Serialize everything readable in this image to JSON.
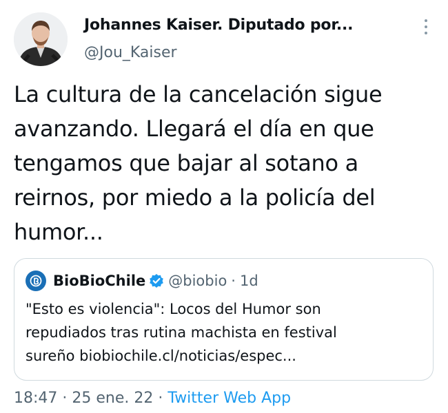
{
  "author": {
    "name": "Johannes Kaiser. Diputado por...",
    "handle": "@Jou_Kaiser"
  },
  "more_icon": "more-vertical-icon",
  "tweet": {
    "lines": [
      "La cultura de la cancelación sigue",
      "avanzando. Llegará el día en que",
      "tengamos que bajar al sotano a",
      "reirnos, por miedo a la policía del",
      "humor..."
    ]
  },
  "quoted": {
    "name": "BioBioChile",
    "handle": "@biobio",
    "separator": "·",
    "time": "1d",
    "verified_icon": "verified-badge-icon",
    "lines": [
      "\"Esto es violencia\": Locos del Humor son",
      "repudiados tras rutina machista en festival",
      "sureño  biobiochile.cl/noticias/espec..."
    ]
  },
  "meta": {
    "time": "18:47",
    "sep1": "·",
    "date": "25 ene. 22",
    "sep2": "·",
    "app": "Twitter Web App"
  },
  "colors": {
    "text": "#0f1419",
    "secondary": "#536471",
    "link": "#1d9bf0",
    "border": "#cfd9de",
    "biobio_blue": "#1a6fb6"
  }
}
